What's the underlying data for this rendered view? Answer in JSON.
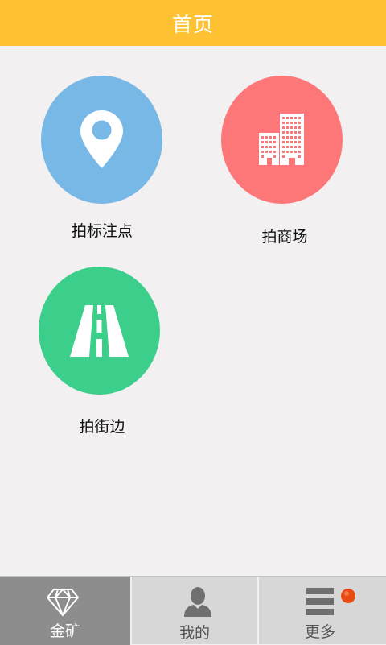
{
  "header": {
    "title": "首页"
  },
  "tiles": [
    {
      "label": "拍标注点",
      "icon": "location-pin-icon",
      "color": "#78b8e6"
    },
    {
      "label": "拍商场",
      "icon": "buildings-icon",
      "color": "#fd7779"
    },
    {
      "label": "拍街边",
      "icon": "road-icon",
      "color": "#3bcf8b"
    }
  ],
  "tabbar": {
    "tabs": [
      {
        "label": "金矿",
        "icon": "diamond-icon",
        "active": true
      },
      {
        "label": "我的",
        "icon": "user-icon",
        "active": false
      },
      {
        "label": "更多",
        "icon": "menu-icon",
        "active": false
      }
    ],
    "active_color": "#8d8d8d",
    "notification_color": "#e84a12"
  }
}
